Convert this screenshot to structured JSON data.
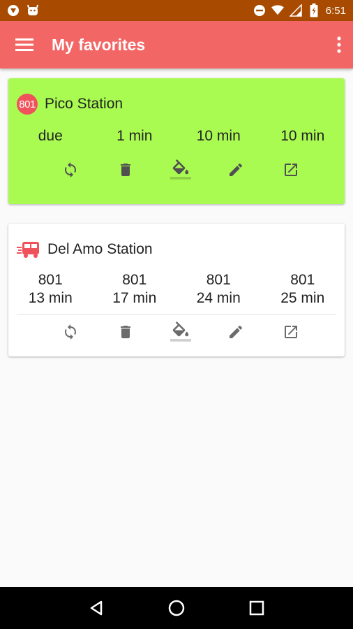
{
  "status_bar": {
    "time": "6:51",
    "left_icons": [
      "shield-notification-icon",
      "android-notification-icon"
    ],
    "right_icons": [
      "do-not-disturb-icon",
      "wifi-icon",
      "signal-icon",
      "battery-charging-icon"
    ]
  },
  "app_bar": {
    "title": "My favorites",
    "menu_icon": "hamburger-menu-icon",
    "overflow_icon": "more-vert-icon",
    "color": "#f26666"
  },
  "favorites": [
    {
      "station": "Pico Station",
      "route_badge": "801",
      "background": "#a9fb52",
      "times": [
        "due",
        "1 min",
        "10 min",
        "10 min"
      ]
    },
    {
      "station": "Del Amo Station",
      "icon": "bus-icon",
      "background": "#ffffff",
      "arrivals": [
        {
          "route": "801",
          "time": "13 min"
        },
        {
          "route": "801",
          "time": "17 min"
        },
        {
          "route": "801",
          "time": "24 min"
        },
        {
          "route": "801",
          "time": "25 min"
        }
      ]
    }
  ],
  "card_actions": [
    "refresh-icon",
    "delete-icon",
    "color-fill-icon",
    "edit-icon",
    "open-external-icon"
  ],
  "nav_bar": [
    "back-icon",
    "home-icon",
    "recents-icon"
  ]
}
